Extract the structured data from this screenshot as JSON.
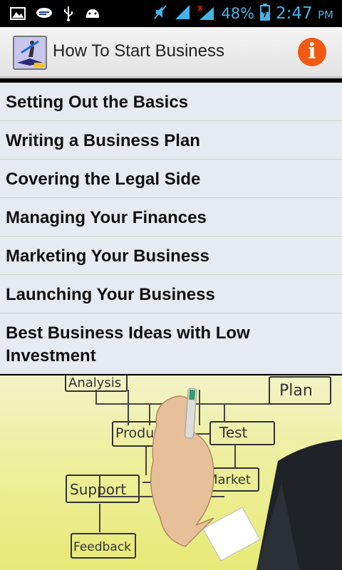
{
  "status_bar": {
    "battery_percent": "48%",
    "time": "2:47",
    "ampm": "PM",
    "icons": [
      "picture-icon",
      "chat-icon",
      "usb-icon",
      "android-icon",
      "mute-icon",
      "signal-icon",
      "signal-x-icon",
      "battery-icon"
    ],
    "color": "#45b3e5"
  },
  "action_bar": {
    "title": "How To Start Business",
    "info_label": "i",
    "info_color": "#f25a14"
  },
  "menu": {
    "items": [
      {
        "label": "Setting Out the Basics"
      },
      {
        "label": "Writing a Business Plan"
      },
      {
        "label": "Covering the Legal Side"
      },
      {
        "label": "Managing Your Finances"
      },
      {
        "label": "Marketing Your Business"
      },
      {
        "label": "Launching Your Business"
      },
      {
        "label": "Best Business Ideas with Low Investment"
      }
    ]
  },
  "illustration": {
    "boxes": [
      "Analysis",
      "Plan",
      "Product",
      "Test",
      "Market",
      "Support",
      "Feedback"
    ]
  }
}
